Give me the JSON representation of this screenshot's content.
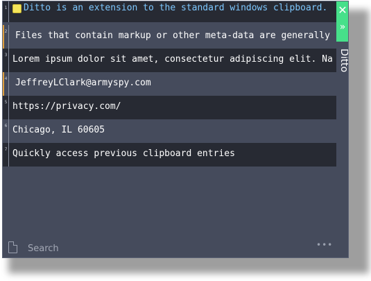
{
  "window": {
    "title": "Ditto",
    "close_glyph": "✕",
    "expand_glyph": "»"
  },
  "clips": [
    {
      "num": "1",
      "text": "Ditto is an extension to the standard windows clipboard.",
      "icon": "note-icon",
      "style": "dark"
    },
    {
      "num": "2",
      "text": "Files that contain markup or other meta-data are generally",
      "icon": "",
      "style": "light",
      "marked": true
    },
    {
      "num": "3",
      "text": "Lorem ipsum dolor sit amet, consectetur adipiscing elit. Na",
      "icon": "",
      "style": "dark"
    },
    {
      "num": "4",
      "text": "JeffreyLClark@armyspy.com",
      "icon": "",
      "style": "light",
      "marked": true
    },
    {
      "num": "5",
      "text": "https://privacy.com/",
      "icon": "",
      "style": "dark"
    },
    {
      "num": "6",
      "text": "Chicago, IL 60605",
      "icon": "",
      "style": "light"
    },
    {
      "num": "7",
      "text": "Quickly access previous clipboard entries",
      "icon": "",
      "style": "dark"
    }
  ],
  "search": {
    "placeholder": "Search",
    "value": "",
    "more_glyph": "•••"
  },
  "colors": {
    "dark_row": "#272a33",
    "light_row": "#454b5c",
    "accent_green": "#47e08a",
    "first_row_text": "#7ec8ff",
    "marker": "#e0a040"
  }
}
